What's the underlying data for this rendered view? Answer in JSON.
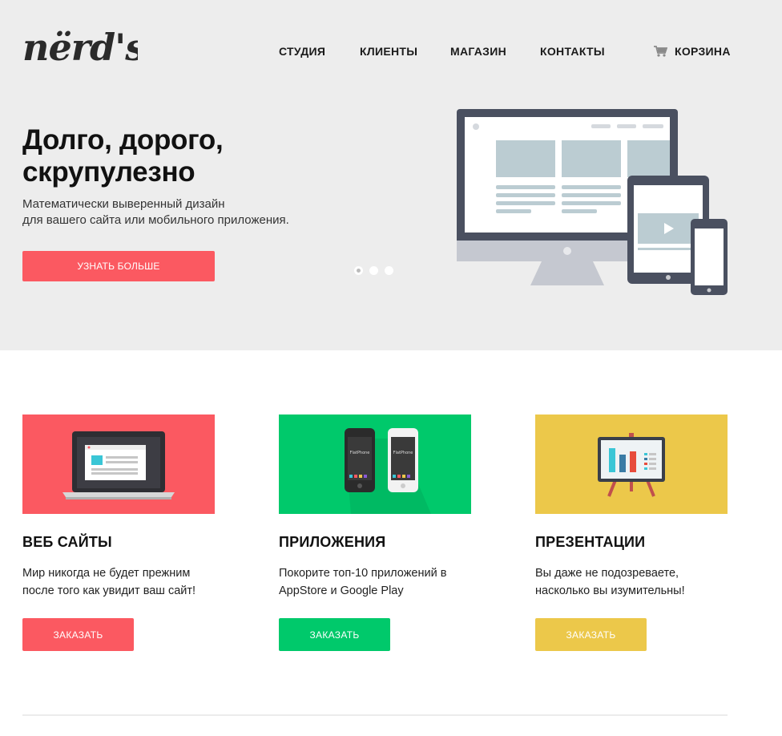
{
  "brand": {
    "logo_text": "nërd's"
  },
  "nav": {
    "items": [
      "СТУДИЯ",
      "КЛИЕНТЫ",
      "МАГАЗИН",
      "КОНТАКТЫ"
    ],
    "cart_label": "КОРЗИНА",
    "cart_icon": "cart-icon"
  },
  "hero": {
    "title": "Долго, дорого, скрупулезно",
    "subtitle_line1": "Математически выверенный дизайн",
    "subtitle_line2": "для вашего сайта или мобильного приложения.",
    "button_label": "УЗНАТЬ БОЛЬШЕ",
    "slider_dots": 3,
    "active_dot": 0,
    "background": "#ededed"
  },
  "cards": [
    {
      "title": "ВЕБ САЙТЫ",
      "line1": "Мир никогда не будет прежним",
      "line2": "после того как увидит ваш сайт!",
      "button_label": "ЗАКАЗАТЬ",
      "color": "#fb5961",
      "image_icon": "laptop-icon"
    },
    {
      "title": "ПРИЛОЖЕНИЯ",
      "line1": "Покорите топ-10 приложений в",
      "line2": "AppStore и Google Play",
      "button_label": "ЗАКАЗАТЬ",
      "color": "#00c96b",
      "image_icon": "phones-icon",
      "phone_label": "FlatPhone"
    },
    {
      "title": "ПРЕЗЕНТАЦИИ",
      "line1": "Вы даже не подозреваете,",
      "line2": "насколько вы изумительны!",
      "button_label": "ЗАКАЗАТЬ",
      "color": "#ecc84a",
      "image_icon": "presentation-board-icon"
    }
  ],
  "colors": {
    "accent_red": "#fb5961",
    "accent_green": "#00c96b",
    "accent_yellow": "#ecc84a",
    "device_dark": "#4a5060"
  }
}
